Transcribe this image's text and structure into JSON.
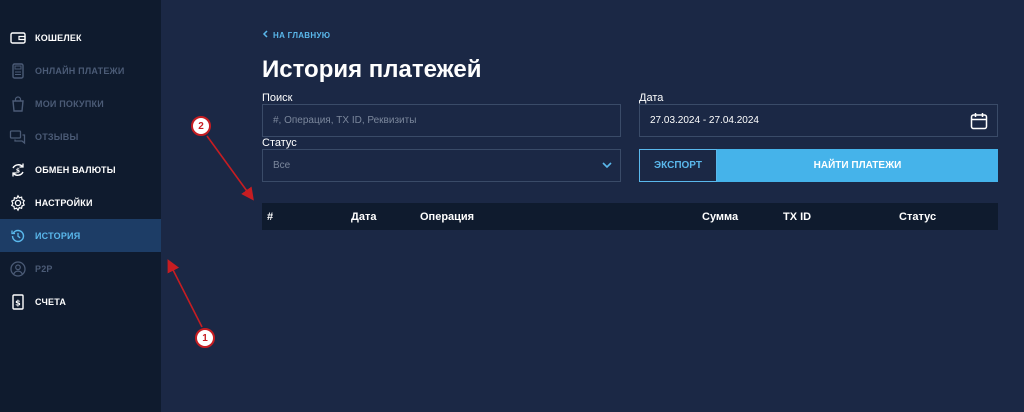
{
  "sidebar": {
    "items": [
      {
        "label": "КОШЕЛЕК",
        "icon": "wallet-icon",
        "state": "normal"
      },
      {
        "label": "ОНЛАЙН ПЛАТЕЖИ",
        "icon": "payment-terminal-icon",
        "state": "disabled"
      },
      {
        "label": "МОИ ПОКУПКИ",
        "icon": "shopping-bag-icon",
        "state": "disabled"
      },
      {
        "label": "ОТЗЫВЫ",
        "icon": "chat-bubbles-icon",
        "state": "disabled"
      },
      {
        "label": "ОБМЕН ВАЛЮТЫ",
        "icon": "currency-exchange-icon",
        "state": "normal"
      },
      {
        "label": "НАСТРОЙКИ",
        "icon": "gear-icon",
        "state": "normal"
      },
      {
        "label": "ИСТОРИЯ",
        "icon": "history-clock-icon",
        "state": "active"
      },
      {
        "label": "P2P",
        "icon": "user-circle-icon",
        "state": "disabled"
      },
      {
        "label": "СЧЕТА",
        "icon": "invoice-dollar-icon",
        "state": "normal"
      }
    ]
  },
  "header": {
    "back_label": "НА ГЛАВНУЮ",
    "title": "История платежей"
  },
  "filters": {
    "search_label": "Поиск",
    "search_placeholder": "#, Операция, TX ID, Реквизиты",
    "date_label": "Дата",
    "date_value": "27.03.2024 - 27.04.2024",
    "status_label": "Статус",
    "status_value": "Все"
  },
  "buttons": {
    "export_label": "ЭКСПОРТ",
    "find_label": "НАЙТИ ПЛАТЕЖИ"
  },
  "table": {
    "columns": [
      "#",
      "Дата",
      "Операция",
      "Сумма",
      "TX ID",
      "Статус"
    ]
  },
  "annotations": {
    "marker_1": "1",
    "marker_2": "2"
  },
  "colors": {
    "accent": "#45b3ea",
    "sidebar_bg": "#0f1b2e",
    "main_bg": "#1b2845",
    "marker_red": "#c61d22"
  }
}
